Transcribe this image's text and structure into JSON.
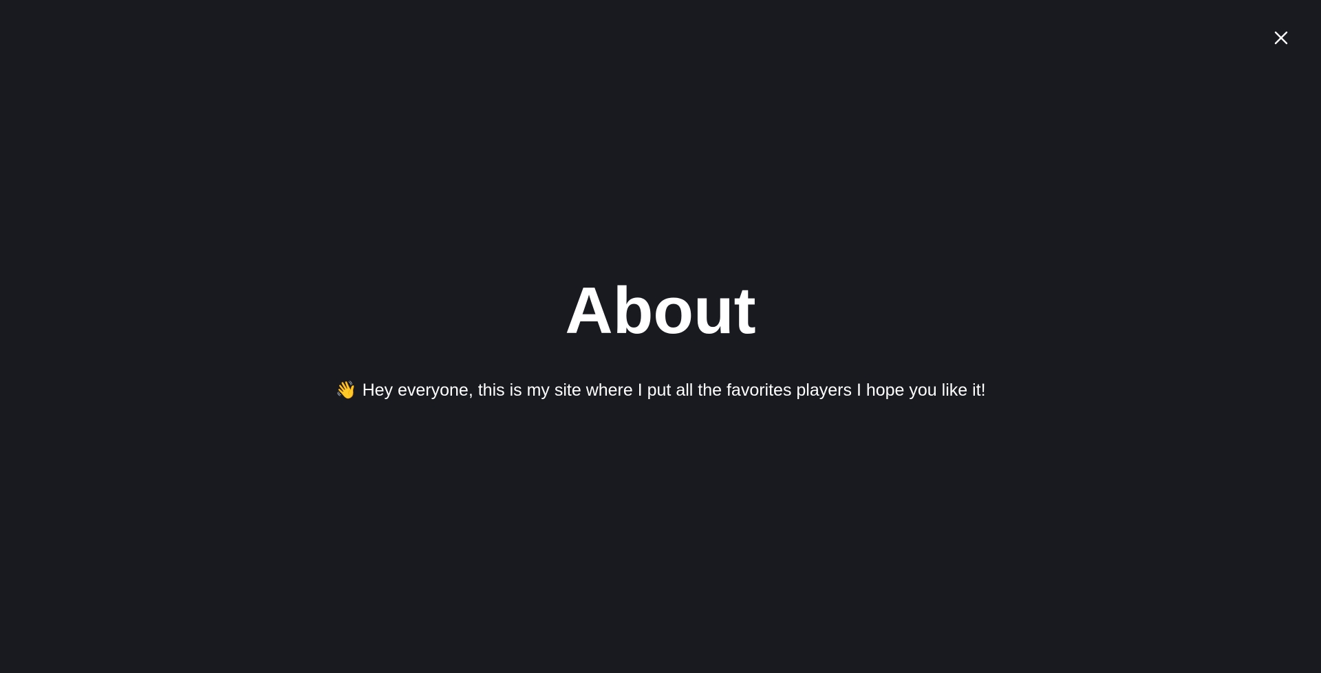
{
  "modal": {
    "close_icon": "close-icon",
    "title": "About",
    "message_emoji": "👋",
    "message_text": "Hey everyone, this is my site where I put all the favorites players I hope you like it!"
  },
  "colors": {
    "background": "#181a1f",
    "text": "#ffffff"
  }
}
